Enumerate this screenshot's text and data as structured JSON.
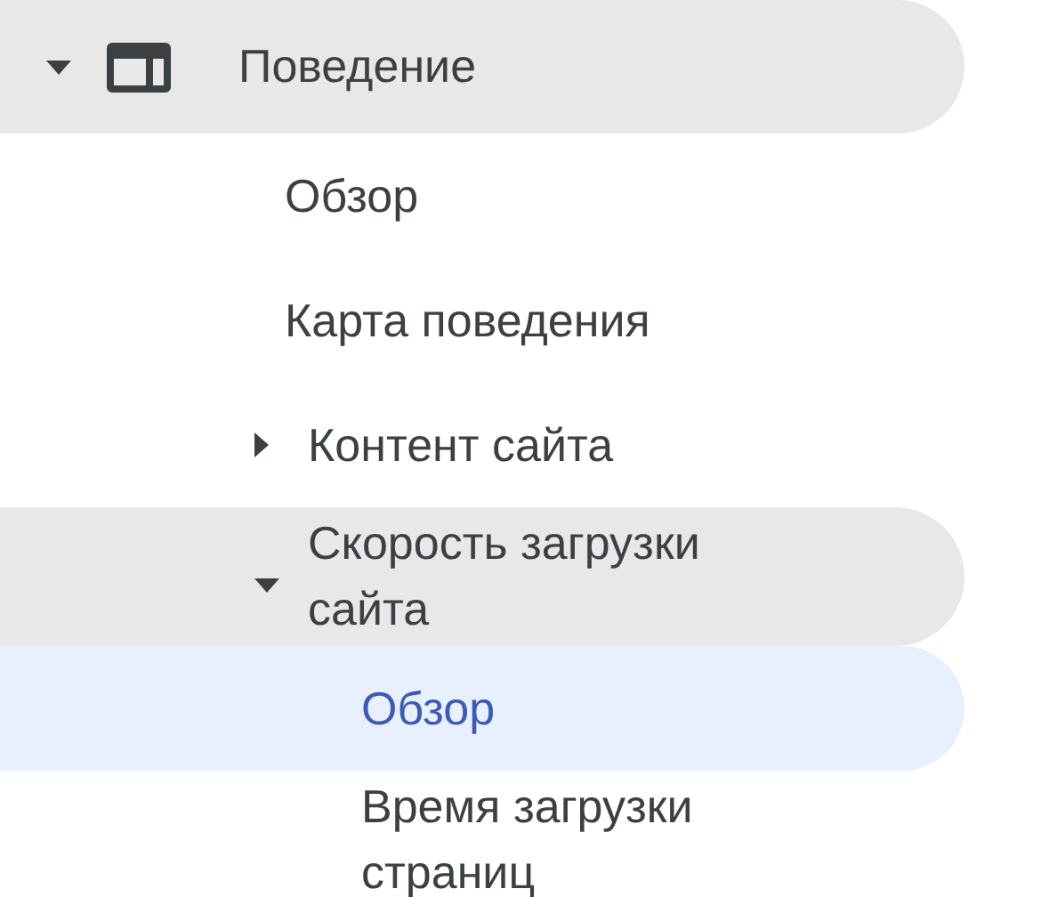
{
  "nav": {
    "label": "Поведение",
    "expanded": true,
    "selected": false,
    "children": [
      {
        "label": "Обзор",
        "selected": false
      },
      {
        "label": "Карта поведения",
        "selected": false
      },
      {
        "label": "Контент сайта",
        "expanded": false,
        "selected": false
      },
      {
        "label": "Скорость загрузки сайта",
        "expanded": true,
        "selected": false,
        "children": [
          {
            "label": "Обзор",
            "selected": true
          },
          {
            "label": "Время загрузки страниц",
            "selected": false
          }
        ]
      }
    ]
  }
}
